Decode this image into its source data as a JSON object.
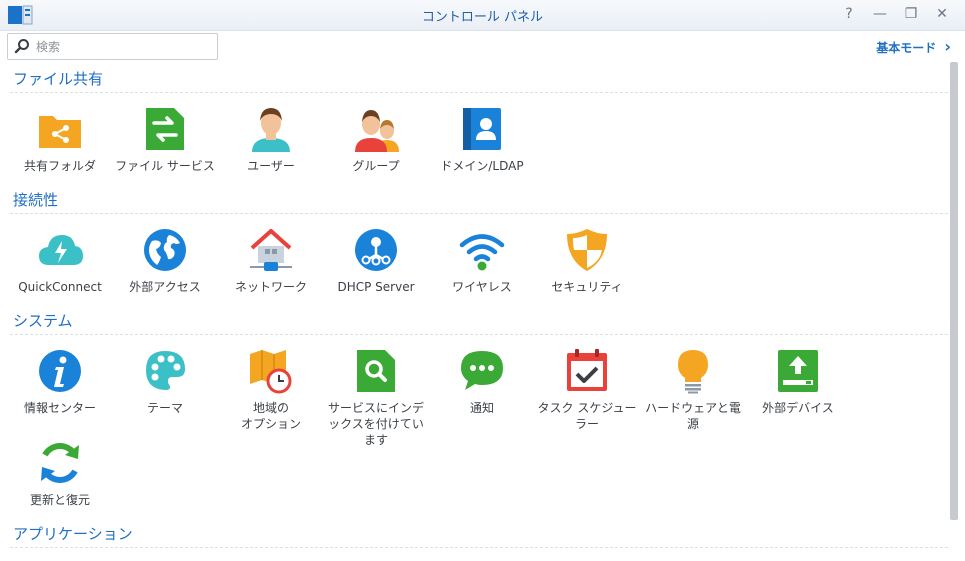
{
  "window": {
    "title": "コントロール パネル"
  },
  "window_controls": {
    "help": "?",
    "minimize": "—",
    "restore": "❐",
    "close": "✕"
  },
  "search": {
    "placeholder": "検索"
  },
  "mode_link": {
    "label": "基本モード",
    "arrow": "›"
  },
  "sections": {
    "file_sharing": {
      "title": "ファイル共有",
      "items": [
        "共有フォルダ",
        "ファイル サービス",
        "ユーザー",
        "グループ",
        "ドメイン/LDAP"
      ]
    },
    "connectivity": {
      "title": "接続性",
      "items": [
        "QuickConnect",
        "外部アクセス",
        "ネットワーク",
        "DHCP Server",
        "ワイヤレス",
        "セキュリティ"
      ]
    },
    "system": {
      "title": "システム",
      "items": [
        "情報センター",
        "テーマ",
        "地域の\nオプション",
        "サービスにインデックスを付けています",
        "通知",
        "タスク スケジューラー",
        "ハードウェアと電源",
        "外部デバイス",
        "更新と復元"
      ]
    },
    "applications": {
      "title": "アプリケーション"
    }
  },
  "colors": {
    "accent": "#1f6fc3",
    "orange": "#f4a623",
    "green": "#3aa935",
    "blue": "#1a82d9",
    "red": "#e8423b",
    "teal": "#3cc0c7"
  }
}
